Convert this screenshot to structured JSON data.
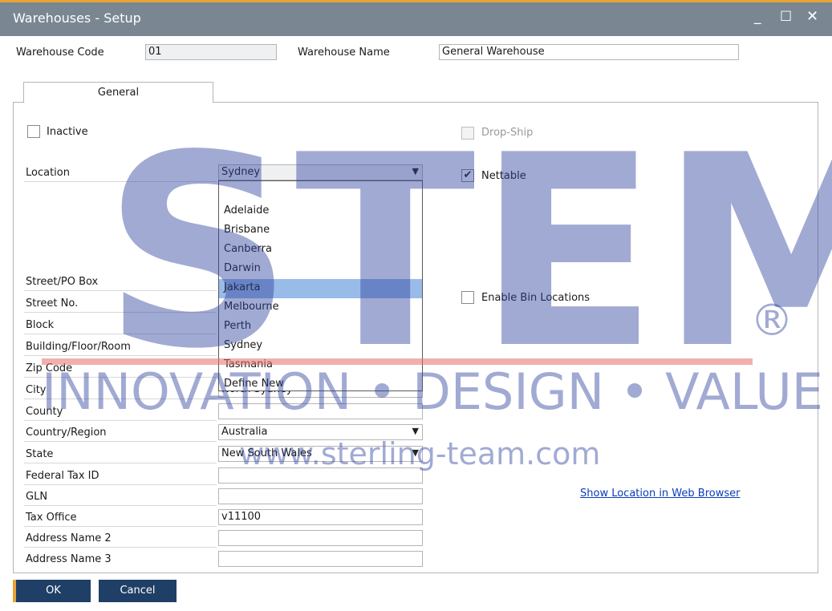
{
  "window": {
    "title": "Warehouses - Setup",
    "minimize": "_",
    "maximize": "☐",
    "close": "✕"
  },
  "header": {
    "warehouse_code_label": "Warehouse Code",
    "warehouse_code_value": "01",
    "warehouse_name_label": "Warehouse Name",
    "warehouse_name_value": "General Warehouse"
  },
  "tabs": [
    {
      "label": "General"
    }
  ],
  "general": {
    "inactive_label": "Inactive",
    "inactive_checked": false,
    "drop_ship_label": "Drop-Ship",
    "drop_ship_checked": false,
    "nettable_label": "Nettable",
    "nettable_checked": true,
    "nettable_mark": "✔",
    "enable_bin_label": "Enable Bin Locations",
    "enable_bin_checked": false,
    "location_label": "Location",
    "location_value": "Sydney",
    "location_options": [
      "",
      "Adelaide",
      "Brisbane",
      "Canberra",
      "Darwin",
      "Jakarta",
      "Melbourne",
      "Perth",
      "Sydney",
      "Tasmania",
      "Define New"
    ],
    "location_highlighted": "Jakarta",
    "fields": [
      {
        "label": "Street/PO Box",
        "value": ""
      },
      {
        "label": "Street No.",
        "value": ""
      },
      {
        "label": "Block",
        "value": ""
      },
      {
        "label": "Building/Floor/Room",
        "value": ""
      },
      {
        "label": "Zip Code",
        "value": ""
      },
      {
        "label": "City",
        "value": "North Sydney"
      },
      {
        "label": "County",
        "value": ""
      },
      {
        "label": "Country/Region",
        "value": "Australia"
      },
      {
        "label": "State",
        "value": "New South Wales"
      },
      {
        "label": "Federal Tax ID",
        "value": ""
      },
      {
        "label": "GLN",
        "value": ""
      },
      {
        "label": "Tax Office",
        "value": "v11100"
      },
      {
        "label": "Address Name 2",
        "value": ""
      },
      {
        "label": "Address Name 3",
        "value": ""
      }
    ],
    "show_location_link": "Show Location in Web Browser"
  },
  "buttons": {
    "ok": "OK",
    "cancel": "Cancel"
  },
  "watermark": {
    "brand": "STEM",
    "registered": "®",
    "tagline": "INNOVATION • DESIGN • VALUE",
    "url": "www.sterling-team.com"
  }
}
